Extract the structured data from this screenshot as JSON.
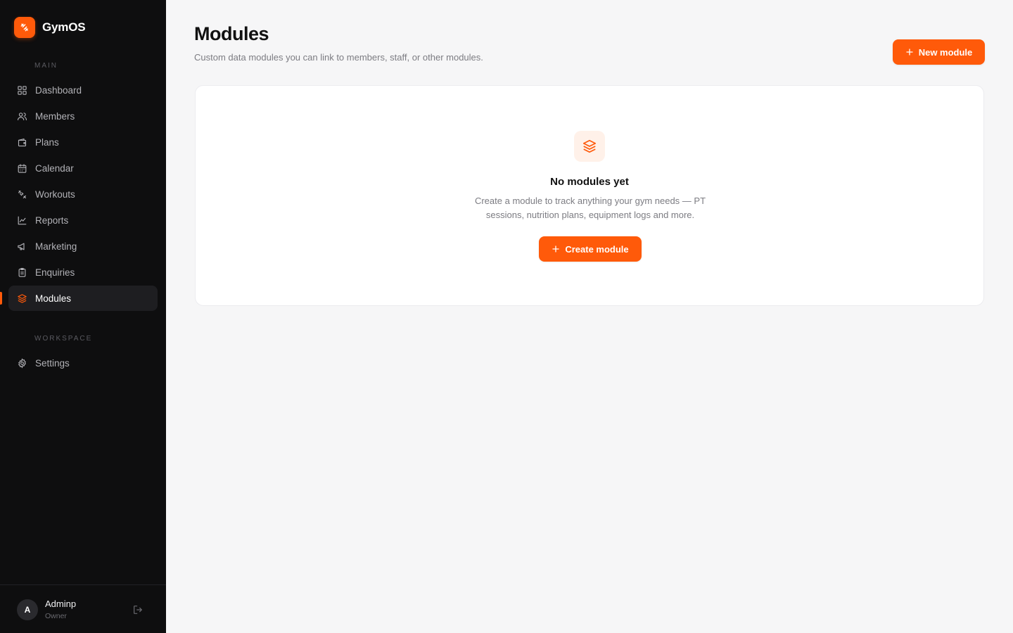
{
  "app": {
    "name": "GymOS"
  },
  "sidebar": {
    "sections": {
      "main": "MAIN",
      "workspace": "WORKSPACE"
    },
    "items": [
      {
        "label": "Dashboard",
        "icon": "dashboard-icon"
      },
      {
        "label": "Members",
        "icon": "members-icon"
      },
      {
        "label": "Plans",
        "icon": "wallet-icon"
      },
      {
        "label": "Calendar",
        "icon": "calendar-icon"
      },
      {
        "label": "Workouts",
        "icon": "dumbbell-icon"
      },
      {
        "label": "Reports",
        "icon": "chart-icon"
      },
      {
        "label": "Marketing",
        "icon": "megaphone-icon"
      },
      {
        "label": "Enquiries",
        "icon": "clipboard-icon"
      },
      {
        "label": "Modules",
        "icon": "layers-icon",
        "active": true
      }
    ],
    "workspace_items": [
      {
        "label": "Settings",
        "icon": "gear-icon"
      }
    ]
  },
  "user": {
    "initial": "A",
    "name": "Adminp",
    "role": "Owner"
  },
  "page": {
    "title": "Modules",
    "subtitle": "Custom data modules you can link to members, staff, or other modules.",
    "new_button": "New module"
  },
  "empty_state": {
    "title": "No modules yet",
    "description": "Create a module to track anything your gym needs — PT sessions, nutrition plans, equipment logs and more.",
    "cta": "Create module"
  },
  "colors": {
    "accent": "#ff5a0a",
    "sidebar_bg": "#0e0e0f",
    "page_bg": "#f6f6f7"
  }
}
